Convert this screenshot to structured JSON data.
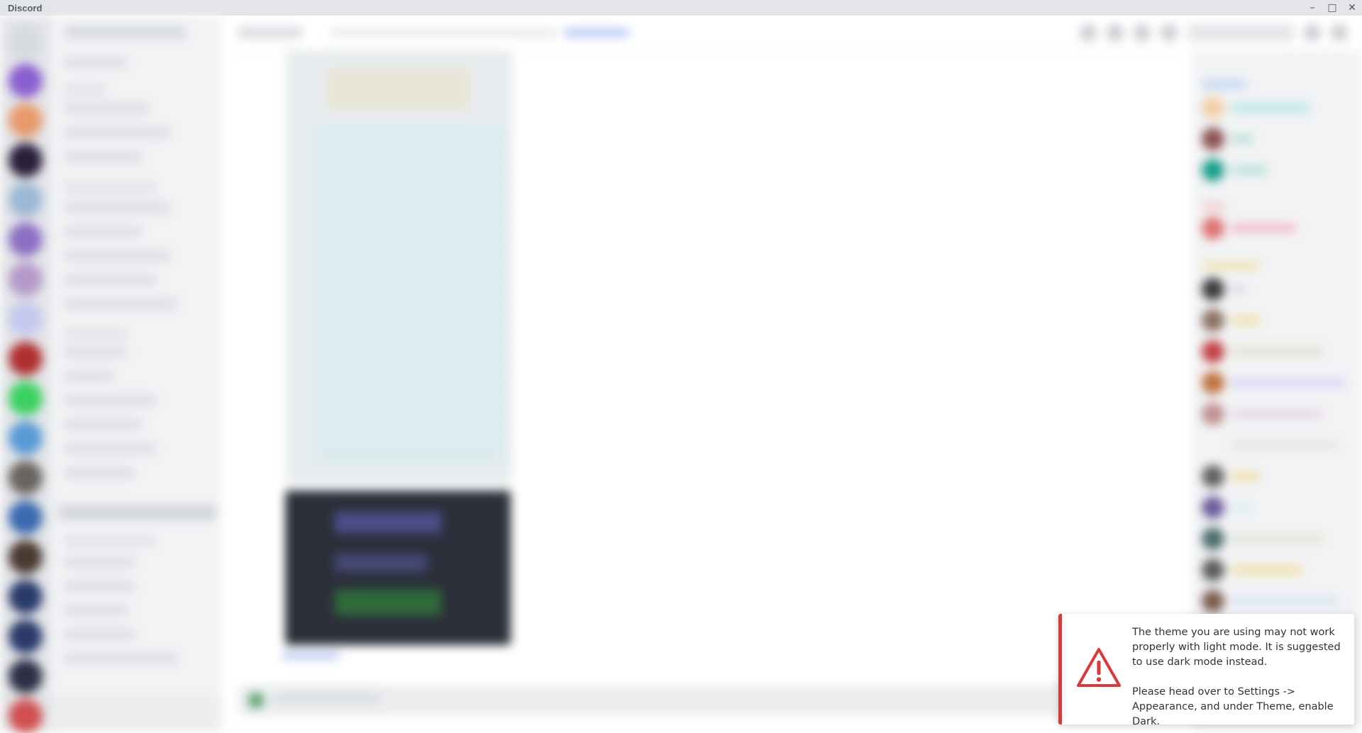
{
  "window": {
    "title": "Discord",
    "controls": [
      "minimize",
      "maximize",
      "close"
    ]
  },
  "colors": {
    "titlebar_bg": "#e3e5e8",
    "toast_accent": "#d63a3a",
    "link": "#0068e0"
  },
  "notification": {
    "icon": "warning-triangle-icon",
    "line1": "The theme you are using may not work properly with light mode. It is suggested to use dark mode instead.",
    "line2": "Please head over to Settings -> Appearance, and under Theme, enable Dark."
  }
}
